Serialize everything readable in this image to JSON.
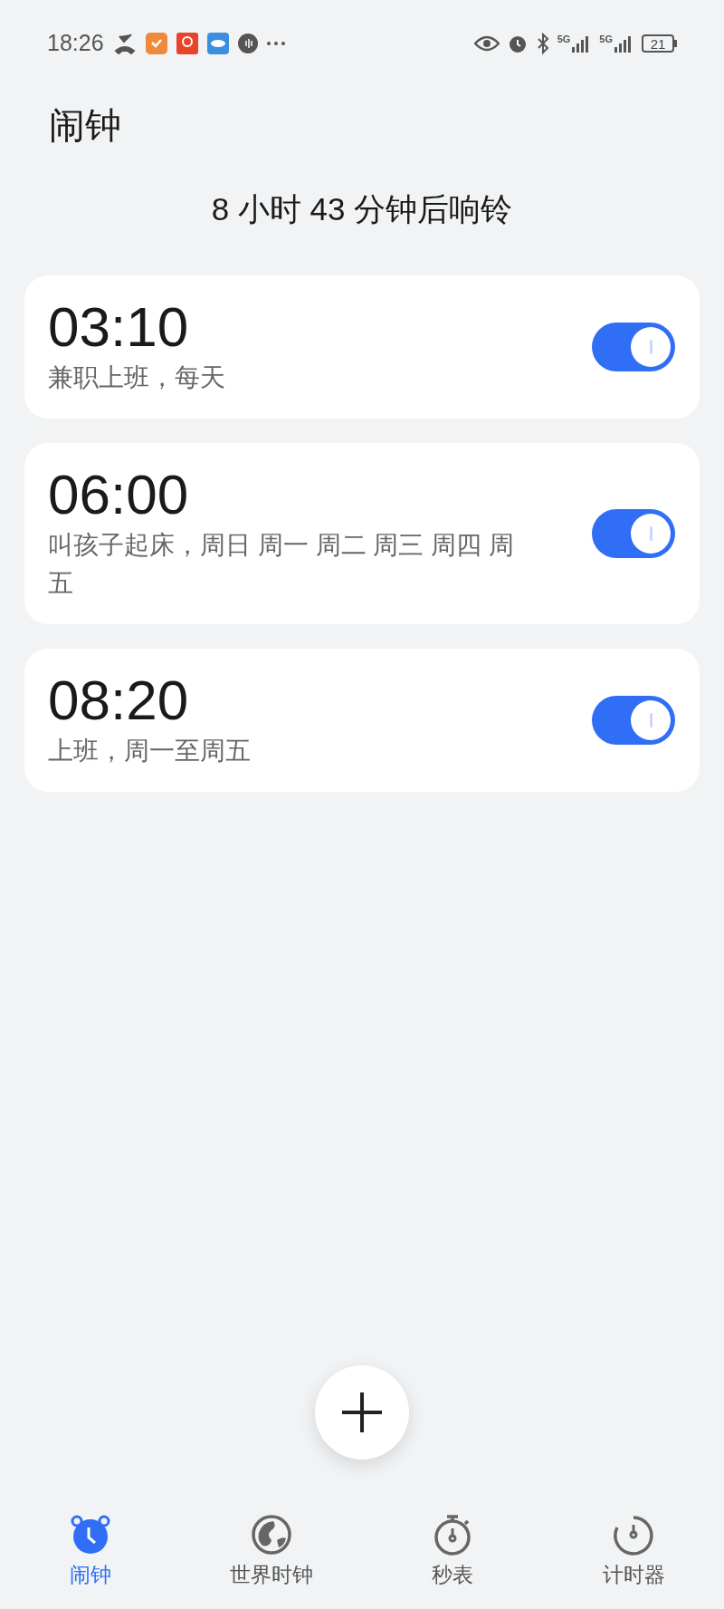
{
  "status_bar": {
    "time": "18:26",
    "signal_1_label": "5G",
    "signal_2_label": "5G",
    "battery": "21"
  },
  "title": "闹钟",
  "next_alarm": "8 小时 43 分钟后响铃",
  "alarms": [
    {
      "time": "03:10",
      "label": "兼职上班，每天",
      "on": true
    },
    {
      "time": "06:00",
      "label": "叫孩子起床，周日 周一 周二 周三 周四 周五",
      "on": true
    },
    {
      "time": "08:20",
      "label": "上班，周一至周五",
      "on": true
    }
  ],
  "tabs": [
    {
      "kind": "alarm",
      "label": "闹钟",
      "selected": true
    },
    {
      "kind": "world",
      "label": "世界时钟",
      "selected": false
    },
    {
      "kind": "stopwatch",
      "label": "秒表",
      "selected": false
    },
    {
      "kind": "timer",
      "label": "计时器",
      "selected": false
    }
  ]
}
